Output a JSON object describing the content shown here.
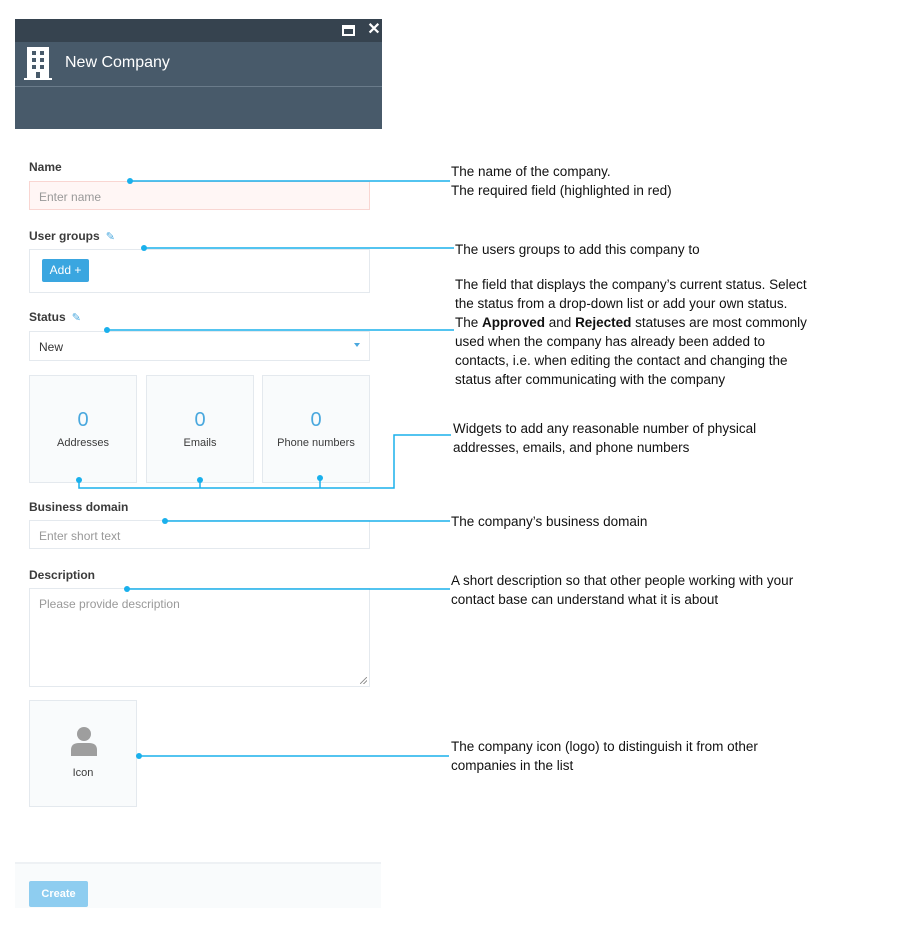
{
  "window": {
    "title": "New Company",
    "maximize_icon": "maximize-icon",
    "close_icon": "close-icon",
    "header_icon": "building-icon"
  },
  "form": {
    "name": {
      "label": "Name",
      "placeholder": "Enter name",
      "value": ""
    },
    "user_groups": {
      "label": "User groups",
      "edit_icon": "pencil-icon",
      "add_button": "Add +"
    },
    "status": {
      "label": "Status",
      "edit_icon": "pencil-icon",
      "selected": "New"
    },
    "widgets": [
      {
        "count": "0",
        "label": "Addresses"
      },
      {
        "count": "0",
        "label": "Emails"
      },
      {
        "count": "0",
        "label": "Phone numbers"
      }
    ],
    "business_domain": {
      "label": "Business domain",
      "placeholder": "Enter short text",
      "value": ""
    },
    "description": {
      "label": "Description",
      "placeholder": "Please provide description",
      "value": ""
    },
    "icon": {
      "label": "Icon",
      "glyph": "person-icon"
    }
  },
  "footer": {
    "create_button": "Create"
  },
  "annotations": {
    "name_line1": "The name of the company.",
    "name_line2": "The required field (highlighted in red)",
    "user_groups": "The users groups to add this company to",
    "status_line1": "The field that displays the company’s current status. Select",
    "status_line2": "the status from a drop-down list or add your own status.",
    "status_line3_pre": "The ",
    "status_line3_b1": "Approved",
    "status_line3_mid": " and ",
    "status_line3_b2": "Rejected",
    "status_line3_post": " statuses are most commonly",
    "status_line4": "used when the company has already been added to",
    "status_line5": "contacts, i.e. when editing the contact and changing the",
    "status_line6": "status after communicating with the company",
    "widgets_line1": "Widgets to add any reasonable number of physical",
    "widgets_line2": "addresses, emails, and phone numbers",
    "business_domain": "The company’s business domain",
    "description_line1": "A short description so that other people working with your",
    "description_line2": "contact base can understand what it is about",
    "icon_line1": "The company icon (logo) to distinguish it from other",
    "icon_line2": "companies in the list"
  },
  "colors": {
    "titlebar": "#36434f",
    "header": "#485a6a",
    "accent": "#3aa6e0",
    "connector": "#1ab0ec",
    "required_bg": "#fff6f5"
  }
}
